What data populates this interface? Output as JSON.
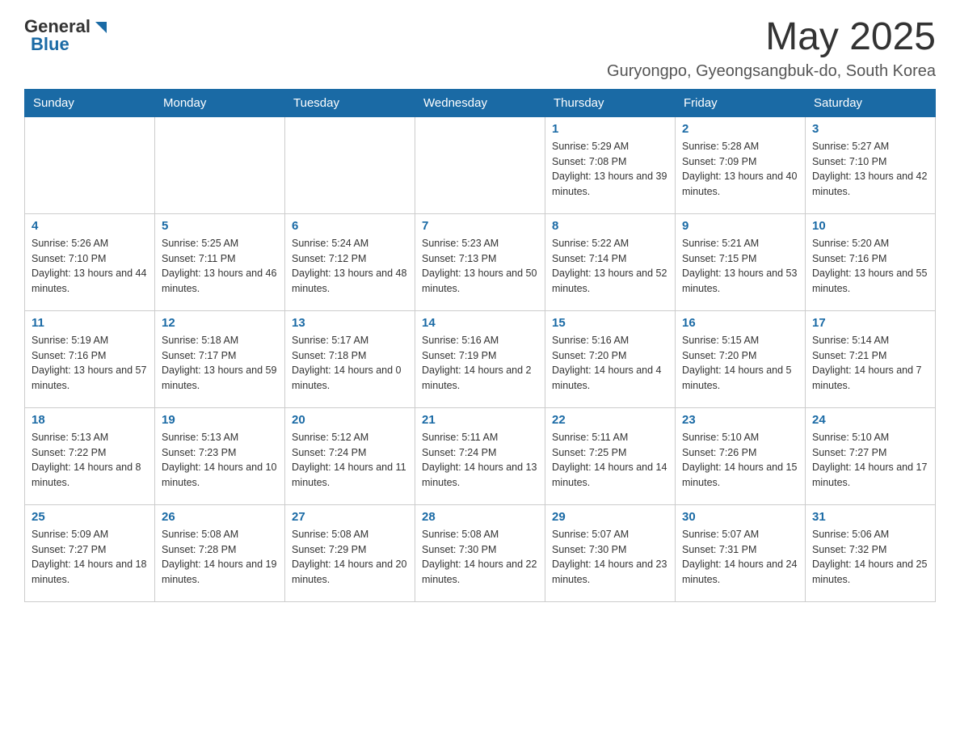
{
  "header": {
    "logo_general": "General",
    "logo_blue": "Blue",
    "month_title": "May 2025",
    "location": "Guryongpo, Gyeongsangbuk-do, South Korea"
  },
  "weekdays": [
    "Sunday",
    "Monday",
    "Tuesday",
    "Wednesday",
    "Thursday",
    "Friday",
    "Saturday"
  ],
  "weeks": [
    [
      {
        "day": "",
        "info": ""
      },
      {
        "day": "",
        "info": ""
      },
      {
        "day": "",
        "info": ""
      },
      {
        "day": "",
        "info": ""
      },
      {
        "day": "1",
        "info": "Sunrise: 5:29 AM\nSunset: 7:08 PM\nDaylight: 13 hours and 39 minutes."
      },
      {
        "day": "2",
        "info": "Sunrise: 5:28 AM\nSunset: 7:09 PM\nDaylight: 13 hours and 40 minutes."
      },
      {
        "day": "3",
        "info": "Sunrise: 5:27 AM\nSunset: 7:10 PM\nDaylight: 13 hours and 42 minutes."
      }
    ],
    [
      {
        "day": "4",
        "info": "Sunrise: 5:26 AM\nSunset: 7:10 PM\nDaylight: 13 hours and 44 minutes."
      },
      {
        "day": "5",
        "info": "Sunrise: 5:25 AM\nSunset: 7:11 PM\nDaylight: 13 hours and 46 minutes."
      },
      {
        "day": "6",
        "info": "Sunrise: 5:24 AM\nSunset: 7:12 PM\nDaylight: 13 hours and 48 minutes."
      },
      {
        "day": "7",
        "info": "Sunrise: 5:23 AM\nSunset: 7:13 PM\nDaylight: 13 hours and 50 minutes."
      },
      {
        "day": "8",
        "info": "Sunrise: 5:22 AM\nSunset: 7:14 PM\nDaylight: 13 hours and 52 minutes."
      },
      {
        "day": "9",
        "info": "Sunrise: 5:21 AM\nSunset: 7:15 PM\nDaylight: 13 hours and 53 minutes."
      },
      {
        "day": "10",
        "info": "Sunrise: 5:20 AM\nSunset: 7:16 PM\nDaylight: 13 hours and 55 minutes."
      }
    ],
    [
      {
        "day": "11",
        "info": "Sunrise: 5:19 AM\nSunset: 7:16 PM\nDaylight: 13 hours and 57 minutes."
      },
      {
        "day": "12",
        "info": "Sunrise: 5:18 AM\nSunset: 7:17 PM\nDaylight: 13 hours and 59 minutes."
      },
      {
        "day": "13",
        "info": "Sunrise: 5:17 AM\nSunset: 7:18 PM\nDaylight: 14 hours and 0 minutes."
      },
      {
        "day": "14",
        "info": "Sunrise: 5:16 AM\nSunset: 7:19 PM\nDaylight: 14 hours and 2 minutes."
      },
      {
        "day": "15",
        "info": "Sunrise: 5:16 AM\nSunset: 7:20 PM\nDaylight: 14 hours and 4 minutes."
      },
      {
        "day": "16",
        "info": "Sunrise: 5:15 AM\nSunset: 7:20 PM\nDaylight: 14 hours and 5 minutes."
      },
      {
        "day": "17",
        "info": "Sunrise: 5:14 AM\nSunset: 7:21 PM\nDaylight: 14 hours and 7 minutes."
      }
    ],
    [
      {
        "day": "18",
        "info": "Sunrise: 5:13 AM\nSunset: 7:22 PM\nDaylight: 14 hours and 8 minutes."
      },
      {
        "day": "19",
        "info": "Sunrise: 5:13 AM\nSunset: 7:23 PM\nDaylight: 14 hours and 10 minutes."
      },
      {
        "day": "20",
        "info": "Sunrise: 5:12 AM\nSunset: 7:24 PM\nDaylight: 14 hours and 11 minutes."
      },
      {
        "day": "21",
        "info": "Sunrise: 5:11 AM\nSunset: 7:24 PM\nDaylight: 14 hours and 13 minutes."
      },
      {
        "day": "22",
        "info": "Sunrise: 5:11 AM\nSunset: 7:25 PM\nDaylight: 14 hours and 14 minutes."
      },
      {
        "day": "23",
        "info": "Sunrise: 5:10 AM\nSunset: 7:26 PM\nDaylight: 14 hours and 15 minutes."
      },
      {
        "day": "24",
        "info": "Sunrise: 5:10 AM\nSunset: 7:27 PM\nDaylight: 14 hours and 17 minutes."
      }
    ],
    [
      {
        "day": "25",
        "info": "Sunrise: 5:09 AM\nSunset: 7:27 PM\nDaylight: 14 hours and 18 minutes."
      },
      {
        "day": "26",
        "info": "Sunrise: 5:08 AM\nSunset: 7:28 PM\nDaylight: 14 hours and 19 minutes."
      },
      {
        "day": "27",
        "info": "Sunrise: 5:08 AM\nSunset: 7:29 PM\nDaylight: 14 hours and 20 minutes."
      },
      {
        "day": "28",
        "info": "Sunrise: 5:08 AM\nSunset: 7:30 PM\nDaylight: 14 hours and 22 minutes."
      },
      {
        "day": "29",
        "info": "Sunrise: 5:07 AM\nSunset: 7:30 PM\nDaylight: 14 hours and 23 minutes."
      },
      {
        "day": "30",
        "info": "Sunrise: 5:07 AM\nSunset: 7:31 PM\nDaylight: 14 hours and 24 minutes."
      },
      {
        "day": "31",
        "info": "Sunrise: 5:06 AM\nSunset: 7:32 PM\nDaylight: 14 hours and 25 minutes."
      }
    ]
  ]
}
